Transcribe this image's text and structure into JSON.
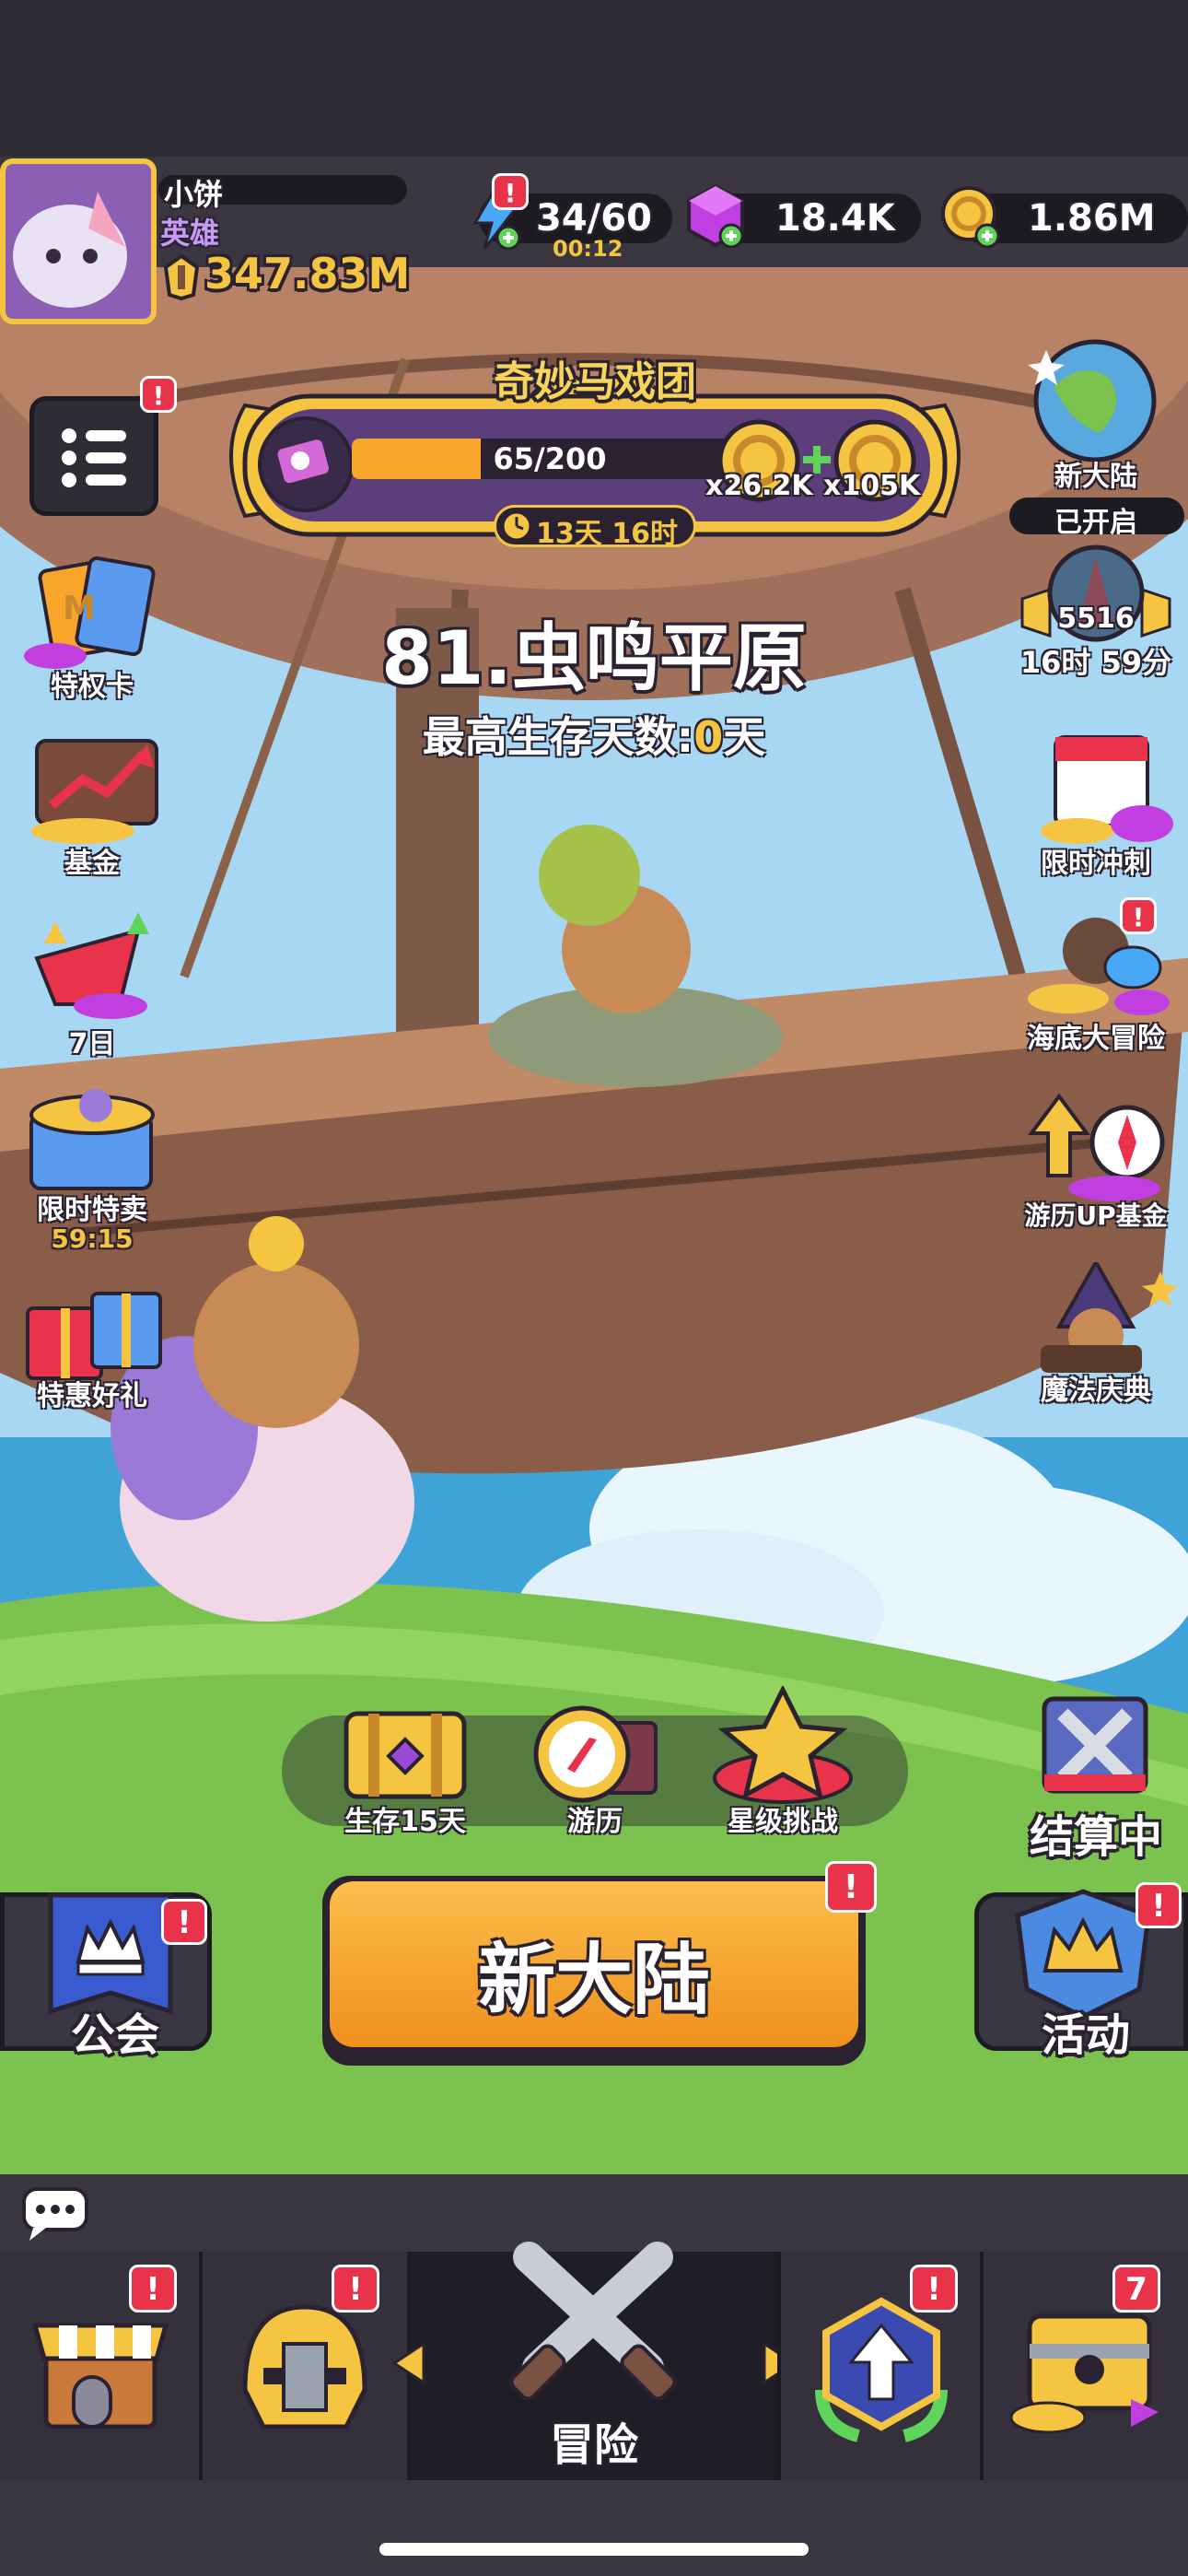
{
  "player": {
    "name": "小饼",
    "rank": "英雄",
    "power": "347.83M"
  },
  "resources": {
    "energy": "34/60",
    "energy_timer": "00:12",
    "gems": "18.4K",
    "coins": "1.86M"
  },
  "event": {
    "title": "奇妙马戏团",
    "progress_text": "65/200",
    "progress": 0.325,
    "reward1": "x26.2K",
    "reward2": "x105K",
    "timer": "13天 16时"
  },
  "stage": {
    "title": "81.虫鸣平原",
    "survival_label": "最高生存天数:",
    "survival_days": "0",
    "survival_unit": "天"
  },
  "left_menu": [
    {
      "label": "特权卡",
      "icon": "privilege-card-icon"
    },
    {
      "label": "基金",
      "icon": "fund-chart-icon"
    },
    {
      "label": "7日",
      "icon": "seven-day-gift-icon"
    },
    {
      "label": "限时特卖",
      "timer": "59:15",
      "icon": "limited-sale-icon"
    },
    {
      "label": "特惠好礼",
      "icon": "special-gift-icon"
    }
  ],
  "right_menu": {
    "new_continent": {
      "label": "新大陆",
      "status": "已开启"
    },
    "tower": {
      "count": "5516",
      "timer": "16时 59分"
    },
    "items": [
      {
        "label": "限时冲刺",
        "icon": "sprint-calendar-icon"
      },
      {
        "label": "海底大冒险",
        "icon": "undersea-adventure-icon"
      },
      {
        "label": "游历UP基金",
        "icon": "travel-fund-icon"
      },
      {
        "label": "魔法庆典",
        "icon": "magic-celebration-icon"
      }
    ]
  },
  "quick_actions": [
    {
      "label": "生存15天",
      "icon": "treasure-chest-icon"
    },
    {
      "label": "游历",
      "icon": "compass-icon"
    },
    {
      "label": "星级挑战",
      "icon": "star-challenge-icon"
    }
  ],
  "settlement": {
    "label": "结算中"
  },
  "guild_label": "公会",
  "main_button": "新大陆",
  "activity_label": "活动",
  "bottom_nav": {
    "center_label": "冒险",
    "chest_badge": "7"
  },
  "colors": {
    "accent_orange": "#f7a52b",
    "badge_red": "#e8334a",
    "gold": "#f5c542",
    "bg_dark": "#2c2a33"
  }
}
